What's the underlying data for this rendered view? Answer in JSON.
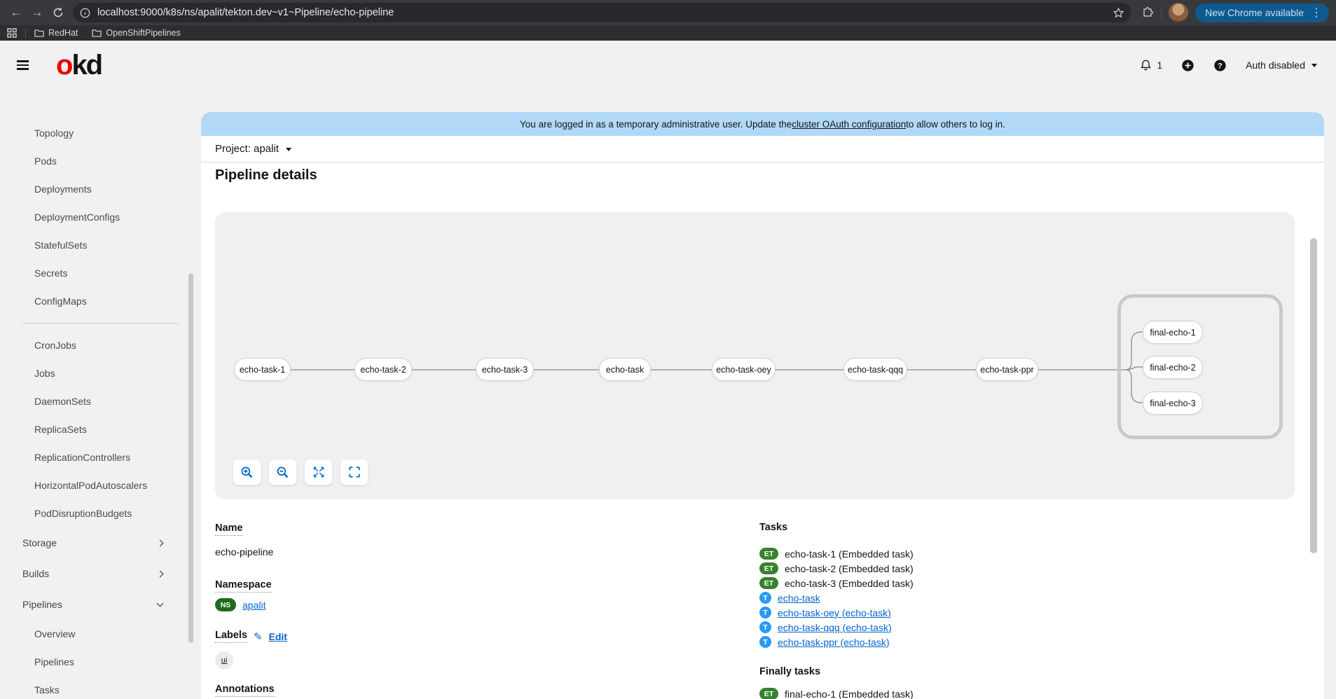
{
  "browser": {
    "url": "localhost:9000/k8s/ns/apalit/tekton.dev~v1~Pipeline/echo-pipeline",
    "bookmarks": [
      {
        "label": "RedHat"
      },
      {
        "label": "OpenShiftPipelines"
      }
    ],
    "update_button": "New Chrome available"
  },
  "masthead": {
    "logo_o": "o",
    "logo_kd": "kd",
    "notification_count": "1",
    "auth_label": "Auth disabled"
  },
  "banner": {
    "text_before": "You are logged in as a temporary administrative user. Update the ",
    "link": "cluster OAuth configuration",
    "text_after": " to allow others to log in."
  },
  "project_bar": {
    "label": "Project: apalit"
  },
  "page": {
    "title": "Pipeline details"
  },
  "sidebar": {
    "items": [
      {
        "label": "Topology",
        "type": "sub"
      },
      {
        "label": "Pods",
        "type": "sub"
      },
      {
        "label": "Deployments",
        "type": "sub"
      },
      {
        "label": "DeploymentConfigs",
        "type": "sub"
      },
      {
        "label": "StatefulSets",
        "type": "sub"
      },
      {
        "label": "Secrets",
        "type": "sub"
      },
      {
        "label": "ConfigMaps",
        "type": "sub"
      },
      {
        "type": "divider"
      },
      {
        "label": "CronJobs",
        "type": "sub"
      },
      {
        "label": "Jobs",
        "type": "sub"
      },
      {
        "label": "DaemonSets",
        "type": "sub"
      },
      {
        "label": "ReplicaSets",
        "type": "sub"
      },
      {
        "label": "ReplicationControllers",
        "type": "sub"
      },
      {
        "label": "HorizontalPodAutoscalers",
        "type": "sub"
      },
      {
        "label": "PodDisruptionBudgets",
        "type": "sub"
      },
      {
        "label": "Storage",
        "type": "top",
        "chevron": "right"
      },
      {
        "label": "Builds",
        "type": "top",
        "chevron": "right"
      },
      {
        "label": "Pipelines",
        "type": "top",
        "chevron": "down"
      },
      {
        "label": "Overview",
        "type": "sub"
      },
      {
        "label": "Pipelines",
        "type": "sub"
      },
      {
        "label": "Tasks",
        "type": "sub"
      }
    ]
  },
  "graph": {
    "tasks": [
      {
        "label": "echo-task-1"
      },
      {
        "label": "echo-task-2"
      },
      {
        "label": "echo-task-3"
      },
      {
        "label": "echo-task"
      },
      {
        "label": "echo-task-oey"
      },
      {
        "label": "echo-task-qqq"
      },
      {
        "label": "echo-task-ppr"
      }
    ],
    "finally_tasks": [
      {
        "label": "final-echo-1"
      },
      {
        "label": "final-echo-2"
      },
      {
        "label": "final-echo-3"
      }
    ]
  },
  "details": {
    "name_label": "Name",
    "name_value": "echo-pipeline",
    "namespace_label": "Namespace",
    "namespace_badge": "NS",
    "namespace_value": "apalit",
    "labels_label": "Labels",
    "labels_edit": "Edit",
    "label_chips": [
      {
        "label": "ui"
      }
    ],
    "annotations_label": "Annotations"
  },
  "tasks": {
    "title": "Tasks",
    "items": [
      {
        "badge": "ET",
        "text": "echo-task-1 (Embedded task)",
        "link": false
      },
      {
        "badge": "ET",
        "text": "echo-task-2 (Embedded task)",
        "link": false
      },
      {
        "badge": "ET",
        "text": "echo-task-3 (Embedded task)",
        "link": false
      },
      {
        "badge": "T",
        "text": "echo-task",
        "link": true
      },
      {
        "badge": "T",
        "text": "echo-task-oey (echo-task)",
        "link": true
      },
      {
        "badge": "T",
        "text": "echo-task-qqq (echo-task)",
        "link": true
      },
      {
        "badge": "T",
        "text": "echo-task-ppr (echo-task)",
        "link": true
      }
    ],
    "finally_title": "Finally tasks",
    "finally_items": [
      {
        "badge": "ET",
        "text": "final-echo-1 (Embedded task)",
        "link": false
      }
    ]
  },
  "colors": {
    "accent_link": "#0066cc",
    "et_badge": "#38812f",
    "t_badge": "#2b9af3",
    "ns_badge": "#1e6b1e",
    "banner_bg": "#b1d9f7",
    "logo_red": "#ee0000"
  }
}
